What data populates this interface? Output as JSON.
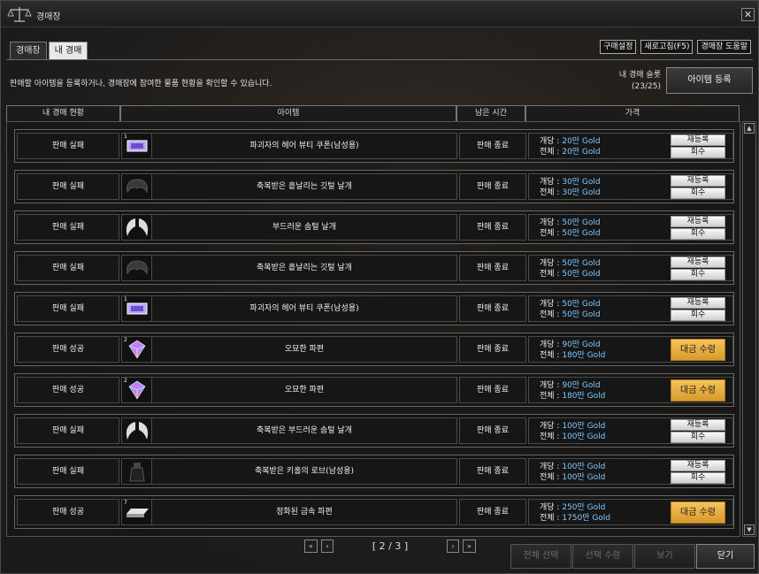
{
  "window": {
    "title": "경매장",
    "close_glyph": "✕"
  },
  "tabs": [
    {
      "label": "경매장"
    },
    {
      "label": "내 경매"
    }
  ],
  "top_buttons": [
    "구매설정",
    "새로고침(F5)",
    "경매장 도움말"
  ],
  "description": "판매할 아이템을 등록하거나, 경매장에 참여한 물품 현황을 확인할 수 있습니다.",
  "slots": {
    "label": "내 경매 슬롯",
    "count": "(23/25)"
  },
  "register_button": "아이템 등록",
  "columns": [
    "내 경매 현황",
    "아이템",
    "남은 시간",
    "가격"
  ],
  "price_labels": {
    "unit": "개당 :",
    "total": "전체 :"
  },
  "row_buttons": {
    "reregister": "재등록",
    "retrieve": "회수",
    "claim": "대금 수령"
  },
  "rows": [
    {
      "status": "판매 실패",
      "qty": "1",
      "icon": "coupon-icon",
      "name": "파괴자의 헤어 뷰티 쿠폰(남성용)",
      "time": "판매 종료",
      "unit_price": "20만 Gold",
      "total_price": "20만 Gold",
      "action": "fail"
    },
    {
      "status": "판매 실패",
      "qty": "",
      "icon": "dark-wings-icon",
      "name": "축복받은 흩날리는 깃털 날개",
      "time": "판매 종료",
      "unit_price": "30만 Gold",
      "total_price": "30만 Gold",
      "action": "fail"
    },
    {
      "status": "판매 실패",
      "qty": "",
      "icon": "white-wings-icon",
      "name": "부드러운 솜털 날개",
      "time": "판매 종료",
      "unit_price": "50만 Gold",
      "total_price": "50만 Gold",
      "action": "fail"
    },
    {
      "status": "판매 실패",
      "qty": "",
      "icon": "dark-wings-icon",
      "name": "축복받은 흩날리는 깃털 날개",
      "time": "판매 종료",
      "unit_price": "50만 Gold",
      "total_price": "50만 Gold",
      "action": "fail"
    },
    {
      "status": "판매 실패",
      "qty": "1",
      "icon": "coupon-icon",
      "name": "파괴자의 헤어 뷰티 쿠폰(남성용)",
      "time": "판매 종료",
      "unit_price": "50만 Gold",
      "total_price": "50만 Gold",
      "action": "fail"
    },
    {
      "status": "판매 성공",
      "qty": "2",
      "icon": "gem-shard-icon",
      "name": "오묘한 파편",
      "time": "판매 종료",
      "unit_price": "90만 Gold",
      "total_price": "180만 Gold",
      "action": "success"
    },
    {
      "status": "판매 성공",
      "qty": "2",
      "icon": "gem-shard-icon",
      "name": "오묘한 파편",
      "time": "판매 종료",
      "unit_price": "90만 Gold",
      "total_price": "180만 Gold",
      "action": "success"
    },
    {
      "status": "판매 실패",
      "qty": "",
      "icon": "white-wings-icon",
      "name": "축복받은 부드러운 솜털 날개",
      "time": "판매 종료",
      "unit_price": "100만 Gold",
      "total_price": "100만 Gold",
      "action": "fail"
    },
    {
      "status": "판매 실패",
      "qty": "",
      "icon": "robe-icon",
      "name": "축복받은 키홀의 로브(남성용)",
      "time": "판매 종료",
      "unit_price": "100만 Gold",
      "total_price": "100만 Gold",
      "action": "fail"
    },
    {
      "status": "판매 성공",
      "qty": "7",
      "icon": "metal-ingot-icon",
      "name": "정화된 금속 파편",
      "time": "판매 종료",
      "unit_price": "250만 Gold",
      "total_price": "1750만 Gold",
      "action": "success"
    }
  ],
  "pagination": {
    "text": "[ 2 / 3 ]",
    "first": "«",
    "prev": "‹",
    "next": "›",
    "last": "»"
  },
  "bottom_buttons": [
    {
      "label": "전체 선택",
      "enabled": false
    },
    {
      "label": "선택 수령",
      "enabled": false
    },
    {
      "label": "보기",
      "enabled": false
    },
    {
      "label": "닫기",
      "enabled": true
    }
  ],
  "colors": {
    "gold_text": "#7ec8ff",
    "claim_button": "#e8ad3e"
  }
}
